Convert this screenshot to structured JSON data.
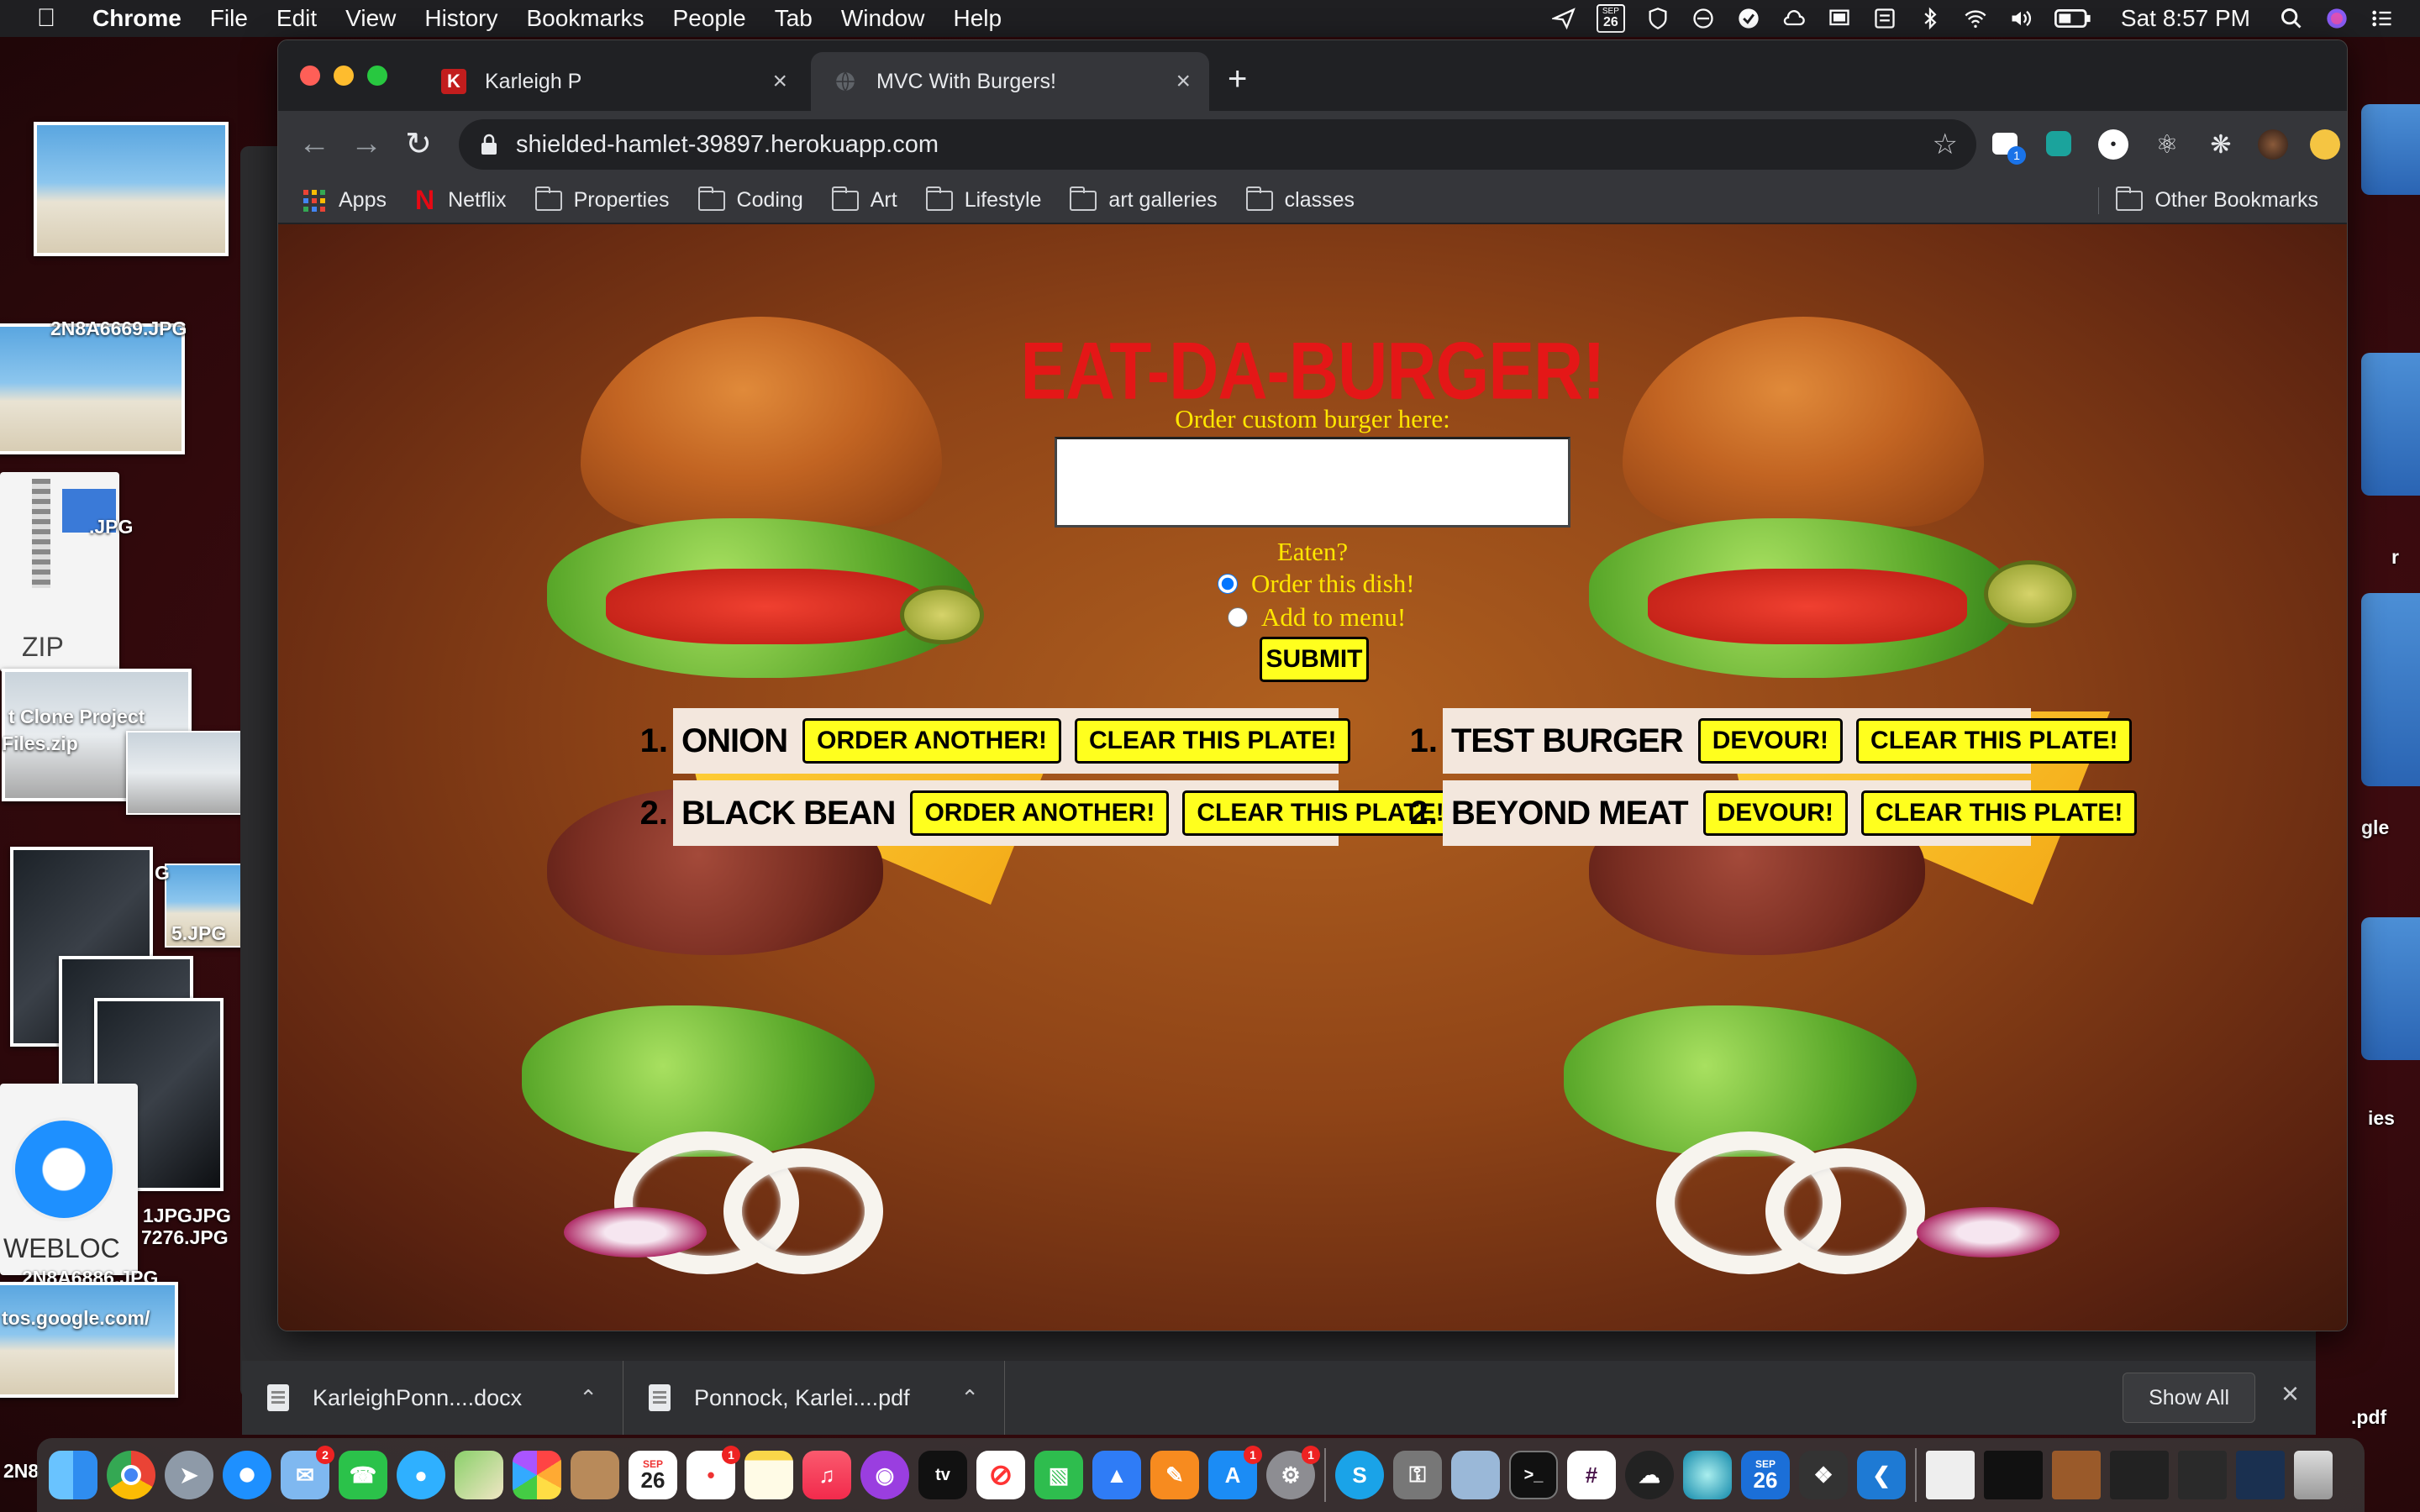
{
  "menubar": {
    "app": "Chrome",
    "items": [
      "File",
      "Edit",
      "View",
      "History",
      "Bookmarks",
      "People",
      "Tab",
      "Window",
      "Help"
    ],
    "calendar_month": "SEP",
    "calendar_day": "26",
    "clock": "Sat 8:57 PM"
  },
  "desktop": {
    "labels": [
      "2N8A6669.JPG",
      ".JPG",
      "ZIP",
      "t Clone Project",
      "Files.zip",
      "G",
      "5.JPG",
      "WEBLOC",
      "1JPGJPG",
      "7276.JPG",
      "2N8A6886.JPG",
      "tos.google.com/",
      "2N8",
      "ies",
      "gle",
      "r",
      ".pdf"
    ]
  },
  "browser": {
    "tabs": [
      {
        "title": "Karleigh P",
        "favicon": "K"
      },
      {
        "title": "MVC With Burgers!",
        "favicon": "globe-icon"
      }
    ],
    "url": "shielded-hamlet-39897.herokuapp.com",
    "extension_badge": "1",
    "bookmarks": [
      "Apps",
      "Netflix",
      "Properties",
      "Coding",
      "Art",
      "Lifestyle",
      "art galleries",
      "classes"
    ],
    "other_bookmarks": "Other Bookmarks"
  },
  "page": {
    "title": "EAT-DA-BURGER!",
    "order_label": "Order custom burger here:",
    "input_value": "",
    "eaten_label": "Eaten?",
    "radio_order": "Order this dish!",
    "radio_menu": "Add to menu!",
    "radio_selected": "order",
    "submit": "SUBMIT",
    "left_list": [
      {
        "num": "1.",
        "name": "ONION",
        "action": "ORDER ANOTHER!",
        "clear": "CLEAR THIS PLATE!"
      },
      {
        "num": "2.",
        "name": "BLACK BEAN",
        "action": "ORDER ANOTHER!",
        "clear": "CLEAR THIS PLATE!"
      }
    ],
    "right_list": [
      {
        "num": "1.",
        "name": "TEST BURGER",
        "action": "DEVOUR!",
        "clear": "CLEAR THIS PLATE!"
      },
      {
        "num": "2.",
        "name": "BEYOND MEAT",
        "action": "DEVOUR!",
        "clear": "CLEAR THIS PLATE!"
      }
    ]
  },
  "downloads": {
    "items": [
      "KarleighPonn....docx",
      "Ponnock, Karlei....pdf"
    ],
    "show_all": "Show All"
  },
  "dock": {
    "mail_badge": "2",
    "reminders_badge": "1",
    "appstore_badge": "1",
    "settings_badge": "1",
    "calendar_month": "SEP",
    "calendar_day": "26"
  },
  "colors": {
    "title_red": "#e41717",
    "label_yellow": "#ffe600",
    "button_yellow": "#ffff1e",
    "card_bg": "#f3e7dd"
  }
}
